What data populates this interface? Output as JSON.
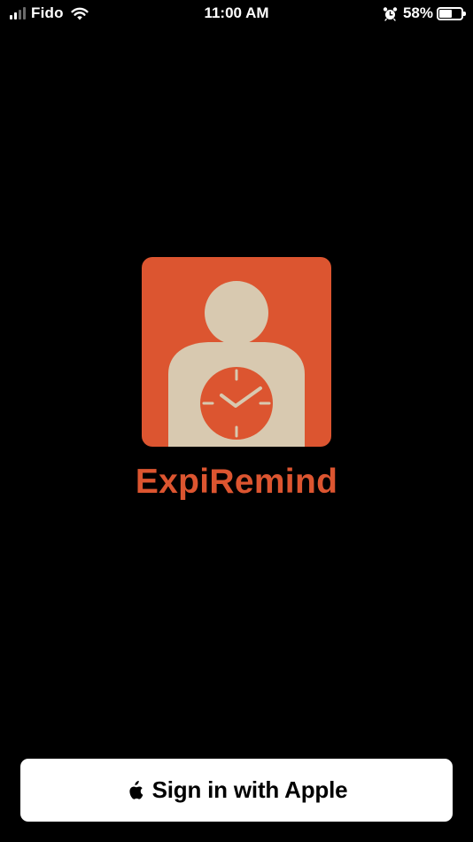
{
  "status_bar": {
    "carrier": "Fido",
    "time": "11:00 AM",
    "battery_percent": "58%",
    "battery_level": 0.58,
    "signal_bars_active": 2,
    "signal_bars_total": 4,
    "icons": [
      "signal-icon",
      "wifi-icon",
      "alarm-icon",
      "battery-icon"
    ]
  },
  "app": {
    "name": "ExpiRemind",
    "logo_icon": "person-with-clock-icon"
  },
  "signin": {
    "label": "Sign in with Apple",
    "icon": "apple-icon"
  },
  "colors": {
    "background": "#000000",
    "brand_orange": "#dc5530",
    "logo_figure": "#d8c9b0",
    "button_background": "#ffffff",
    "button_text": "#000000"
  }
}
